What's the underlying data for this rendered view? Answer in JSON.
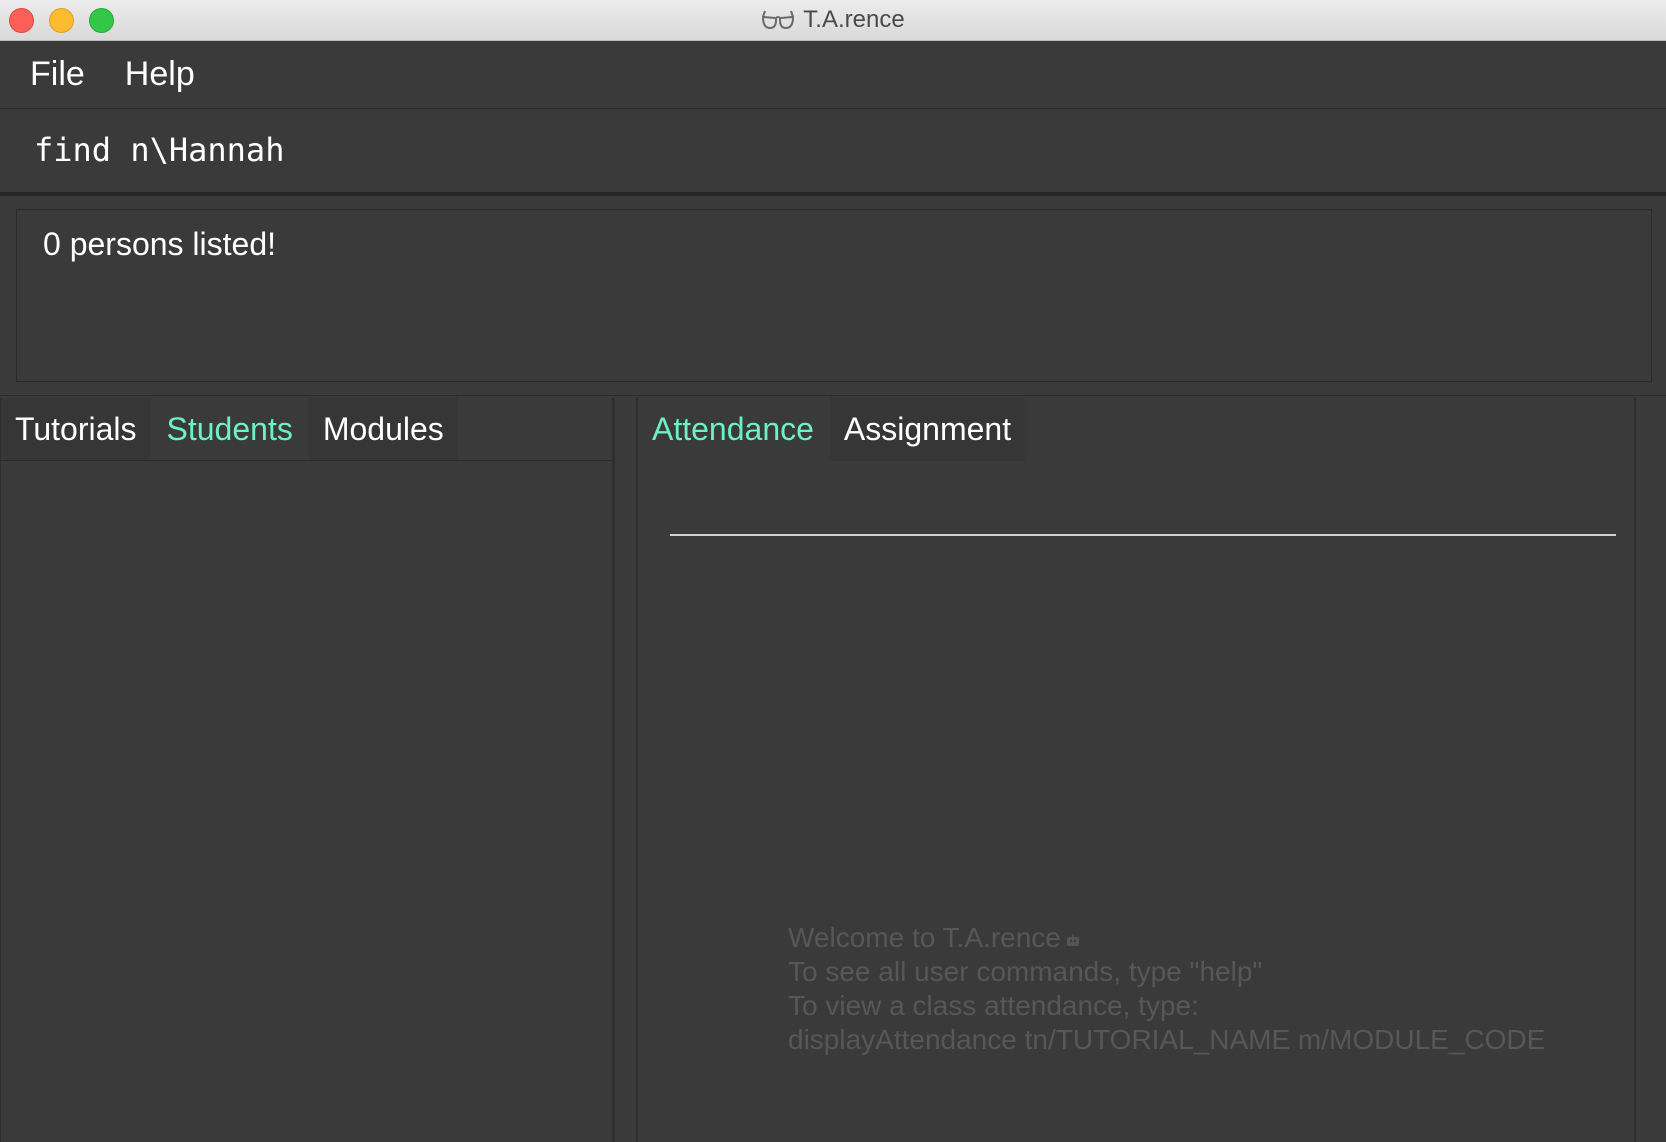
{
  "window": {
    "title": "T.A.rence",
    "title_icon": "glasses-icon",
    "controls": [
      "close",
      "minimize",
      "maximize"
    ]
  },
  "menu": {
    "items": [
      {
        "label": "File"
      },
      {
        "label": "Help"
      }
    ]
  },
  "command": {
    "value": "find n\\Hannah"
  },
  "result": {
    "message": "0 persons listed!"
  },
  "left_pane": {
    "tabs": [
      {
        "label": "Tutorials",
        "selected": false
      },
      {
        "label": "Students",
        "selected": true
      },
      {
        "label": "Modules",
        "selected": false
      }
    ]
  },
  "right_pane": {
    "tabs": [
      {
        "label": "Attendance",
        "selected": true
      },
      {
        "label": "Assignment",
        "selected": false
      }
    ],
    "welcome": {
      "line1": "Welcome to T.A.rence",
      "line1_icon": "robot-icon",
      "line2": "To see all user commands, type \"help\"",
      "line3": "To view a class attendance, type:",
      "line4": "displayAttendance tn/TUTORIAL_NAME m/MODULE_CODE"
    }
  },
  "colors": {
    "background": "#3a3a3a",
    "selected_tab": "#6ef0c2",
    "welcome_text": "#575757",
    "close": "#fc5f57",
    "minimize": "#fdbc2e",
    "maximize": "#33c748"
  }
}
